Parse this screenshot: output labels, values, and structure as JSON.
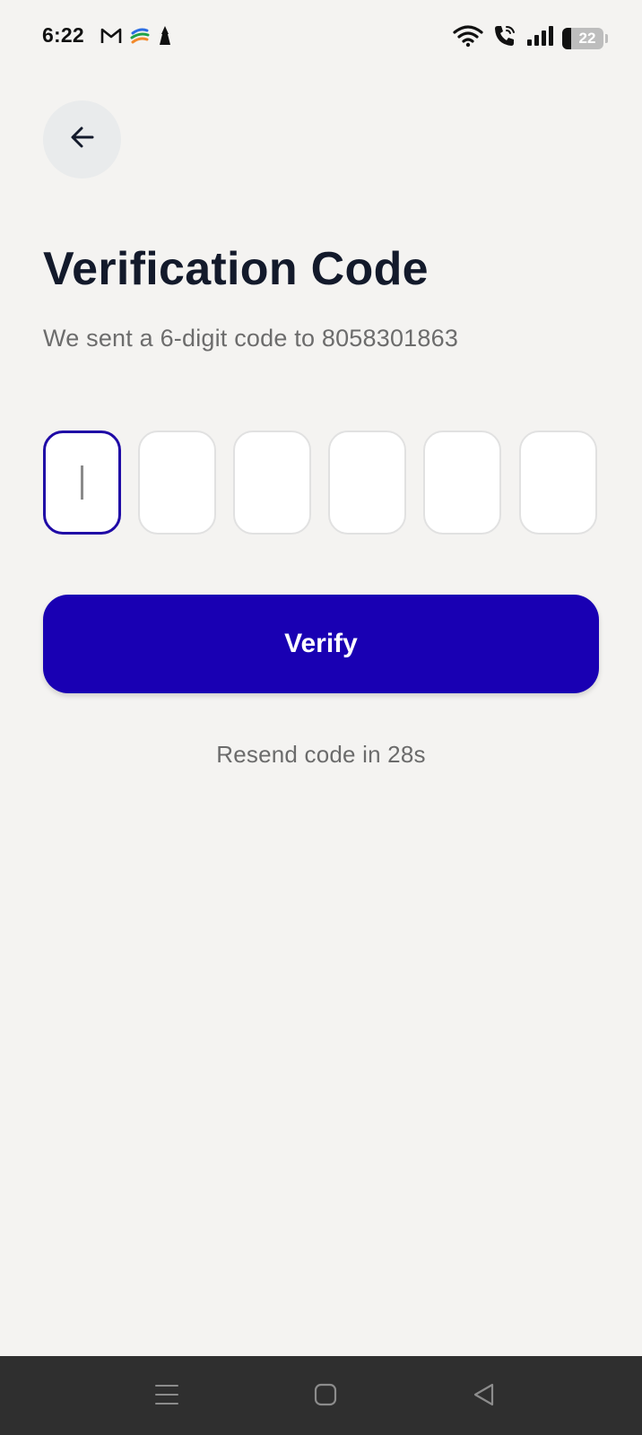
{
  "status_bar": {
    "time": "6:22",
    "left_icons": [
      "gmail-icon",
      "app-logo-icon",
      "notification-icon"
    ],
    "right_icons": [
      "wifi-icon",
      "wifi-call-icon",
      "signal-icon"
    ],
    "battery_level": 22,
    "battery_label": "22"
  },
  "header": {
    "back_icon": "arrow-left-icon"
  },
  "main": {
    "title": "Verification Code",
    "subtitle": "We sent a 6-digit code to 8058301863",
    "otp_digits": [
      "",
      "",
      "",
      "",
      "",
      ""
    ],
    "active_index": 0,
    "verify_label": "Verify",
    "resend_text": "Resend code in 28s"
  },
  "nav_bar": {
    "icons": [
      "menu-icon",
      "home-icon",
      "back-triangle-icon"
    ]
  },
  "colors": {
    "background": "#f4f3f1",
    "primary": "#1900b3",
    "active_border": "#1f0aa6",
    "title": "#131a2b",
    "muted_text": "#6b6b6b",
    "nav_bar": "#2f2f2f"
  }
}
